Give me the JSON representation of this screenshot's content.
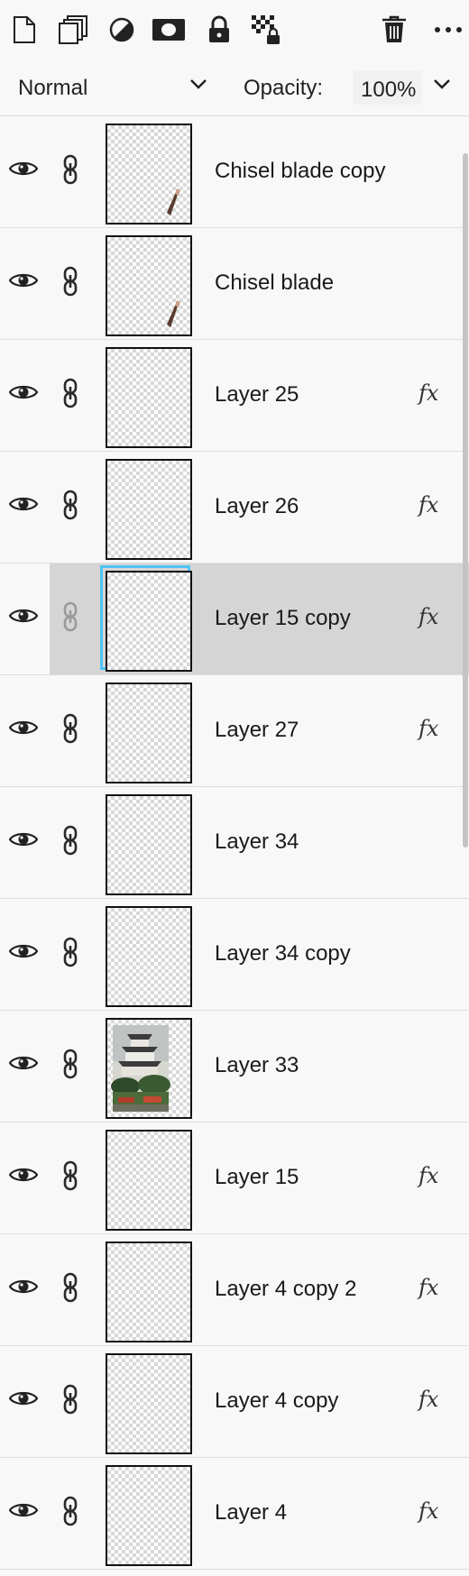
{
  "toolbar": {
    "icons": [
      "new-layer-icon",
      "duplicate-icon",
      "adjustment-icon",
      "mask-icon",
      "lock-icon",
      "lock-transparency-icon",
      "trash-icon",
      "more-icon"
    ]
  },
  "blend": {
    "mode": "Normal",
    "opacity_label": "Opacity:",
    "opacity_value": "100%"
  },
  "layers": [
    {
      "name": "Chisel blade copy",
      "fx": "",
      "thumb": "chisel"
    },
    {
      "name": "Chisel blade",
      "fx": "",
      "thumb": "chisel"
    },
    {
      "name": "Layer 25",
      "fx": "fx",
      "thumb": "empty"
    },
    {
      "name": "Layer 26",
      "fx": "fx",
      "thumb": "empty"
    },
    {
      "name": "Layer 15 copy",
      "fx": "fx",
      "thumb": "empty",
      "selected": true
    },
    {
      "name": "Layer 27",
      "fx": "fx",
      "thumb": "empty"
    },
    {
      "name": "Layer 34",
      "fx": "",
      "thumb": "empty"
    },
    {
      "name": "Layer 34 copy",
      "fx": "",
      "thumb": "empty"
    },
    {
      "name": "Layer 33",
      "fx": "",
      "thumb": "castle"
    },
    {
      "name": "Layer 15",
      "fx": "fx",
      "thumb": "empty"
    },
    {
      "name": "Layer 4 copy 2",
      "fx": "fx",
      "thumb": "empty"
    },
    {
      "name": "Layer 4 copy",
      "fx": "fx",
      "thumb": "empty"
    },
    {
      "name": "Layer 4",
      "fx": "fx",
      "thumb": "empty"
    }
  ],
  "colors": {
    "selection": "#d5d5d5",
    "selection_outline": "#4fc3f7"
  }
}
